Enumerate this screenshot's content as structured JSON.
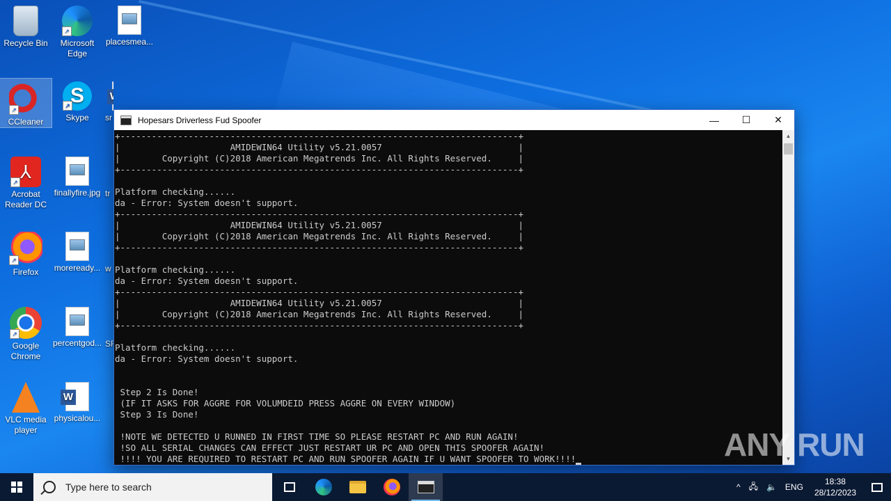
{
  "desktop": {
    "icons": [
      {
        "label": "Recycle Bin"
      },
      {
        "label": "Microsoft Edge"
      },
      {
        "label": "placesmea..."
      },
      {
        "label": "CCleaner"
      },
      {
        "label": "Skype"
      },
      {
        "label": "Acrobat Reader DC"
      },
      {
        "label": "finallyfire.jpg"
      },
      {
        "label": "Firefox"
      },
      {
        "label": "moreready..."
      },
      {
        "label": "Google Chrome"
      },
      {
        "label": "percentgod..."
      },
      {
        "label": "VLC media player"
      },
      {
        "label": "physicalou..."
      }
    ],
    "partial_labels": [
      "sr",
      "tr",
      "w",
      "SF"
    ]
  },
  "window": {
    "title": "Hopesars Driverless Fud Spoofer",
    "minimize_glyph": "—",
    "maximize_glyph": "☐",
    "close_glyph": "✕",
    "console_text": "+----------------------------------------------------------------------------+\n|                     AMIDEWIN64 Utility v5.21.0057                          |\n|        Copyright (C)2018 American Megatrends Inc. All Rights Reserved.     |\n+----------------------------------------------------------------------------+\n\nPlatform checking......\nda - Error: System doesn't support.\n+----------------------------------------------------------------------------+\n|                     AMIDEWIN64 Utility v5.21.0057                          |\n|        Copyright (C)2018 American Megatrends Inc. All Rights Reserved.     |\n+----------------------------------------------------------------------------+\n\nPlatform checking......\nda - Error: System doesn't support.\n+----------------------------------------------------------------------------+\n|                     AMIDEWIN64 Utility v5.21.0057                          |\n|        Copyright (C)2018 American Megatrends Inc. All Rights Reserved.     |\n+----------------------------------------------------------------------------+\n\nPlatform checking......\nda - Error: System doesn't support.\n\n\n Step 2 Is Done!\n (IF IT ASKS FOR AGGRE FOR VOLUMDEID PRESS AGGRE ON EVERY WINDOW)\n Step 3 Is Done!\n\n !NOTE WE DETECTED U RUNNED IN FIRST TIME SO PLEASE RESTART PC AND RUN AGAIN!\n !SO ALL SERIAL CHANGES CAN EFFECT JUST RESTART UR PC AND OPEN THIS SPOOFER AGAIN!\n !!!! YOU ARE REQUIRED TO RESTART PC AND RUN SPOOFER AGAIN IF U WANT SPOOFER TO WORK!!!!"
  },
  "watermark": "ANY RUN",
  "taskbar": {
    "search_placeholder": "Type here to search",
    "tray": {
      "chevron": "^",
      "language": "ENG",
      "time": "18:38",
      "date": "28/12/2023"
    }
  }
}
